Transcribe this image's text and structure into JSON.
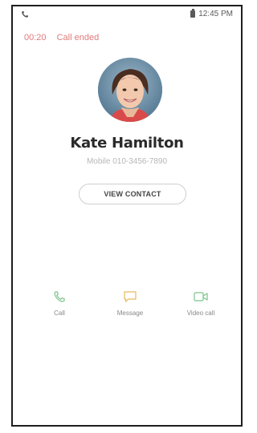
{
  "status_bar": {
    "time": "12:45 PM"
  },
  "call": {
    "duration": "00:20",
    "status": "Call ended"
  },
  "contact": {
    "name": "Kate Hamilton",
    "number": "Mobile 010-3456-7890"
  },
  "buttons": {
    "view_contact": "VIEW CONTACT"
  },
  "actions": [
    {
      "label": "Call",
      "icon": "phone-icon",
      "color": "#7cc48a"
    },
    {
      "label": "Message",
      "icon": "message-icon",
      "color": "#e9b95a"
    },
    {
      "label": "Video call",
      "icon": "video-icon",
      "color": "#7cc48a"
    }
  ],
  "colors": {
    "call_info": "#e07a7a",
    "name": "#2a2a2a",
    "frame": "#1e1e1e"
  }
}
